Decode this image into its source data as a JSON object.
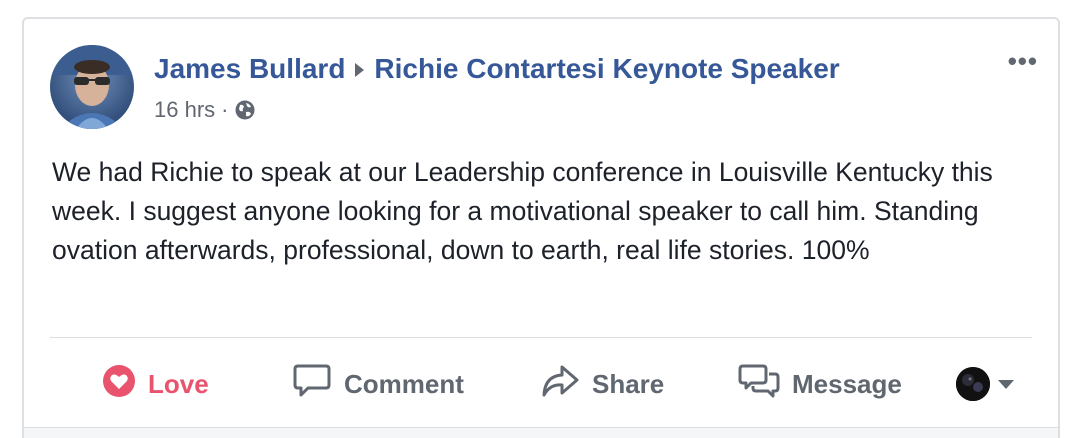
{
  "post": {
    "author": "James Bullard",
    "target_page": "Richie Contartesi Keynote Speaker",
    "time": "16 hrs",
    "separator": "·",
    "privacy_icon": "globe-icon",
    "more_icon": "more-dots-icon",
    "text": "We had Richie to speak at our Leadership conference in Louisville Kentucky this week. I suggest anyone looking for a motivational speaker to call him. Standing ovation afterwards, professional, down to earth, real life stories. 100%"
  },
  "actions": {
    "love": {
      "label": "Love",
      "icon": "heart-icon",
      "color": "#e9536d"
    },
    "comment": {
      "label": "Comment",
      "icon": "comment-icon"
    },
    "share": {
      "label": "Share",
      "icon": "share-arrow-icon"
    },
    "message": {
      "label": "Message",
      "icon": "messenger-icon"
    },
    "audience": {
      "icon": "profile-avatar",
      "caret": "chevron-down-icon"
    }
  },
  "colors": {
    "link": "#365899",
    "text": "#1d2129",
    "muted": "#606770",
    "love": "#e9536d",
    "border": "#dddfe2"
  }
}
